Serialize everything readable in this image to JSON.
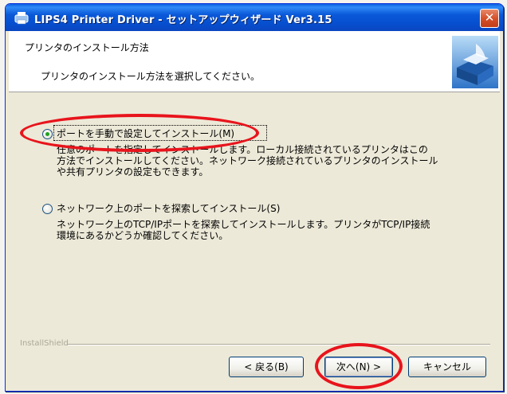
{
  "window": {
    "title": "LIPS4 Printer Driver - セットアップウィザード Ver3.15",
    "close_label": "✕"
  },
  "header": {
    "title": "プリンタのインストール方法",
    "subtitle": "プリンタのインストール方法を選択してください。"
  },
  "options": [
    {
      "label": "ポートを手動で設定してインストール(M)",
      "selected": true,
      "description_lines": [
        "任意のポートを指定してインストールします。ローカル接続されているプリンタはこの",
        "方法でインストールしてください。ネットワーク接続されているプリンタのインストール",
        "や共有プリンタの設定もできます。"
      ]
    },
    {
      "label": "ネットワーク上のポートを探索してインストール(S)",
      "selected": false,
      "description_lines": [
        "ネットワーク上のTCP/IPポートを探索してインストールします。プリンタがTCP/IP接続",
        "環境にあるかどうか確認してください。"
      ]
    }
  ],
  "footer": {
    "group_label": "InstallShield"
  },
  "buttons": {
    "back": "< 戻る(B)",
    "next": "次へ(N) >",
    "cancel": "キャンセル"
  },
  "colors": {
    "annotation": "#e8141c",
    "titlebar": "#0a58d8"
  }
}
